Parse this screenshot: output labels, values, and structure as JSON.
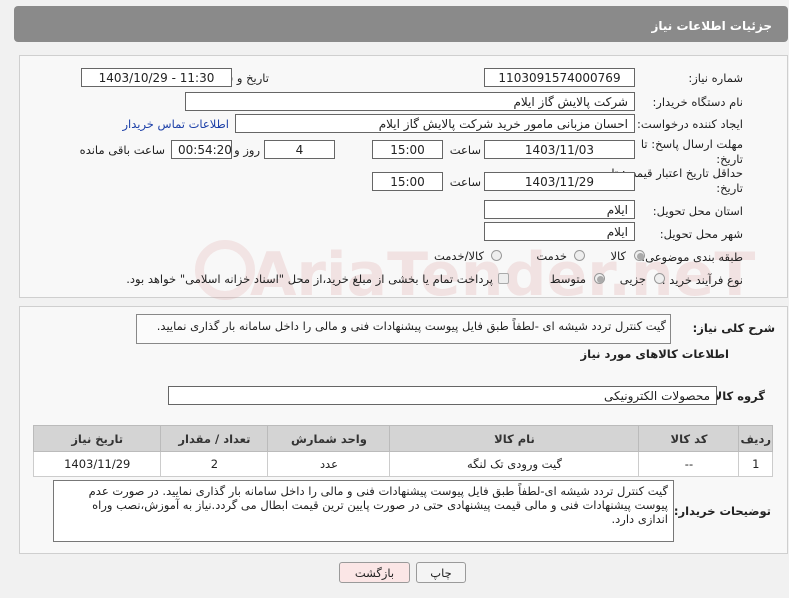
{
  "header": {
    "title": "جزئیات اطلاعات نیاز"
  },
  "labels": {
    "need_number": "شماره نیاز:",
    "announce_datetime": "تاریخ و ساعت اعلان عمومی:",
    "buyer_org": "نام دستگاه خریدار:",
    "requester": "ایجاد کننده درخواست:",
    "contact_link": "اطلاعات تماس خریدار",
    "reply_deadline_1": "مهلت ارسال پاسخ: تا",
    "reply_deadline_2": "تاریخ:",
    "time_word": "ساعت",
    "day_and": "روز و",
    "remaining": "ساعت باقی مانده",
    "price_validity_1": "حداقل تاریخ اعتبار قیمت: تا",
    "price_validity_2": "تاریخ:",
    "delivery_province": "استان محل تحویل:",
    "delivery_city": "شهر محل تحویل:",
    "category": "طبقه بندی موضوعی:",
    "process_type": "نوع فرآیند خرید :",
    "description_title": "شرح کلی نیاز:",
    "items_title": "اطلاعات کالاهای مورد نیاز",
    "goods_group": "گروه کالا:",
    "buyer_notes": "توضیحات خریدار:"
  },
  "fields": {
    "need_number": "1103091574000769",
    "announce_datetime": "1403/10/29 - 11:30",
    "buyer_org": "شرکت پالایش گاز ایلام",
    "requester": "احسان مزبانی مامور خرید شرکت پالایش گاز ایلام",
    "reply_date": "1403/11/03",
    "reply_time": "15:00",
    "days_remaining": "4",
    "time_remaining": "00:54:20",
    "validity_date": "1403/11/29",
    "validity_time": "15:00",
    "province": "ایلام",
    "city": "ایلام",
    "goods_group": "محصولات الکترونیکی"
  },
  "category_options": [
    {
      "label": "کالا",
      "selected": true
    },
    {
      "label": "خدمت",
      "selected": false
    },
    {
      "label": "کالا/خدمت",
      "selected": false
    }
  ],
  "process_options": [
    {
      "label": "جزیی",
      "selected": false
    },
    {
      "label": "متوسط",
      "selected": true
    }
  ],
  "payment_note": "پرداخت تمام یا بخشی از مبلغ خرید،از محل \"اسناد خزانه اسلامی\" خواهد بود.",
  "description": "گیت کنترل تردد شیشه ای -لطفاً طبق فایل پیوست پیشنهادات فنی و مالی را داخل سامانه بار گذاری نمایید.",
  "table": {
    "headers": [
      "ردیف",
      "کد کالا",
      "نام کالا",
      "واحد شمارش",
      "تعداد / مقدار",
      "تاریخ نیاز"
    ],
    "rows": [
      [
        "1",
        "--",
        "گیت ورودی تک لنگه",
        "عدد",
        "2",
        "1403/11/29"
      ]
    ]
  },
  "buyer_notes": "گیت کنترل تردد شیشه ای-لطفاً طبق فایل پیوست پیشنهادات فنی و مالی را داخل سامانه بار گذاری نمایید. در صورت عدم پیوست پیشنهادات فنی و مالی قیمت پیشنهادی حتی در صورت پایین ترین قیمت ابطال می گردد.نیاز به آموزش،نصب وراه اندازی دارد.",
  "buttons": {
    "print": "چاپ",
    "back": "بازگشت"
  },
  "watermark": "AriaTender.neT"
}
